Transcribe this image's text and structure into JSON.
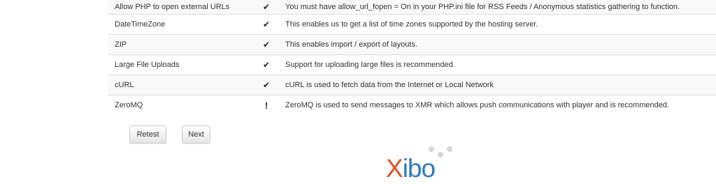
{
  "requirements": [
    {
      "item": "Allow PHP to open external URLs",
      "status": "✔",
      "advice": "You must have allow_url_fopen = On in your PHP.ini file for RSS Feeds / Anonymous statistics gathering to function."
    },
    {
      "item": "DateTimeZone",
      "status": "✔",
      "advice": "This enables us to get a list of time zones supported by the hosting server."
    },
    {
      "item": "ZIP",
      "status": "✔",
      "advice": "This enables import / export of layouts."
    },
    {
      "item": "Large File Uploads",
      "status": "✔",
      "advice": "Support for uploading large files is recommended."
    },
    {
      "item": "cURL",
      "status": "✔",
      "advice": "cURL is used to fetch data from the Internet or Local Network"
    },
    {
      "item": "ZeroMQ",
      "status": "!",
      "advice": "ZeroMQ is used to send messages to XMR which allows push communications with player and is recommended."
    }
  ],
  "buttons": {
    "retest": "Retest",
    "next": "Next"
  },
  "logo": {
    "first_letter": "X",
    "rest": "ibo",
    "colors": {
      "x": "#d9532b",
      "rest": "#2e7ab8",
      "dots": "#d6d6d6"
    }
  }
}
